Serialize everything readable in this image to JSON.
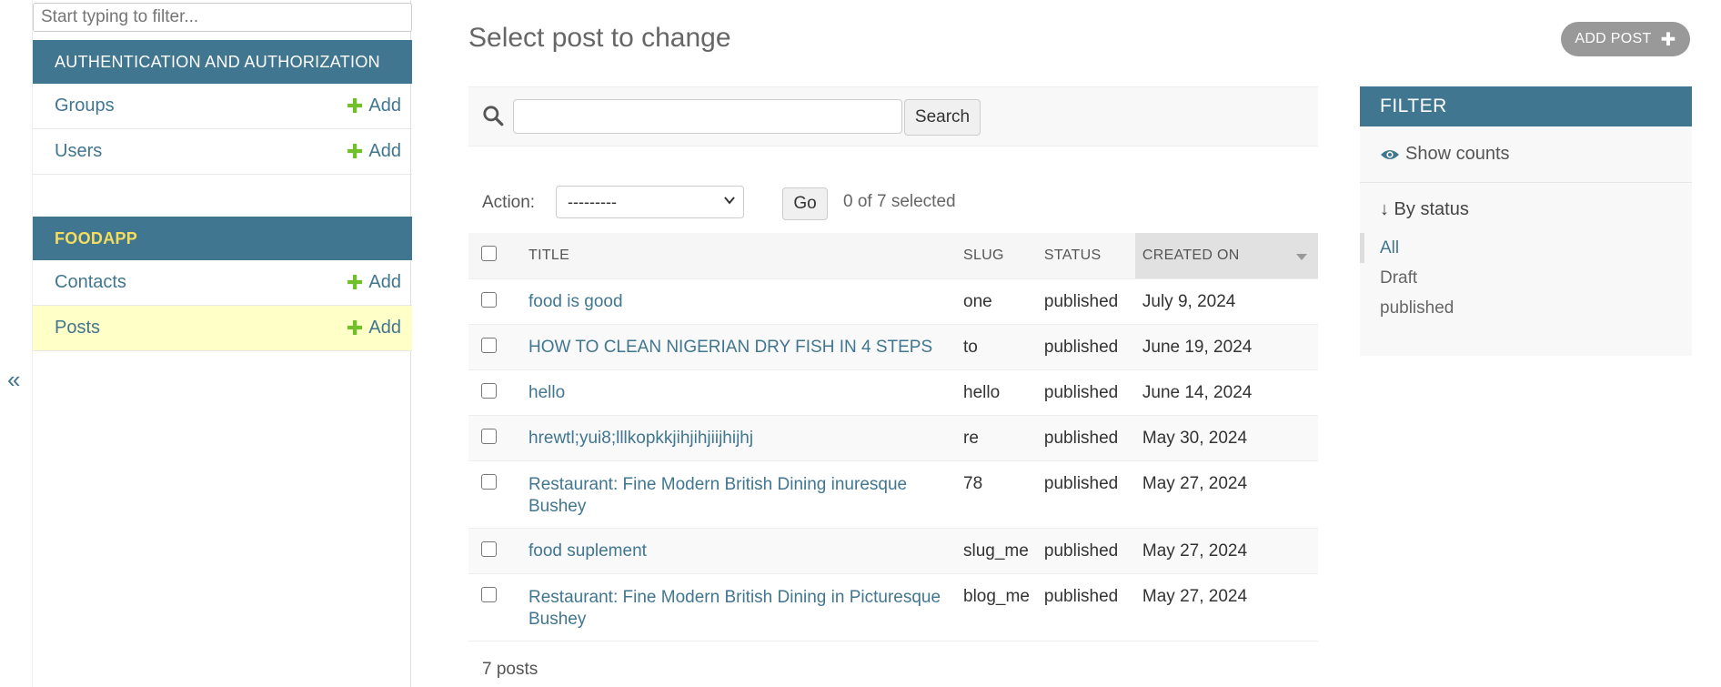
{
  "sidebar": {
    "filter_placeholder": "Start typing to filter...",
    "collapse_glyph": "«",
    "apps": [
      {
        "name": "AUTHENTICATION AND AUTHORIZATION",
        "models": [
          {
            "name": "Groups",
            "add_label": "Add"
          },
          {
            "name": "Users",
            "add_label": "Add"
          }
        ]
      },
      {
        "name": "FOODAPP",
        "models": [
          {
            "name": "Contacts",
            "add_label": "Add"
          },
          {
            "name": "Posts",
            "add_label": "Add",
            "current": true
          }
        ]
      }
    ]
  },
  "main": {
    "title": "Select post to change",
    "add_button": "ADD POST",
    "search_button": "Search",
    "action_label": "Action:",
    "action_value": "---------",
    "go_label": "Go",
    "selected_text": "0 of 7 selected",
    "columns": [
      "TITLE",
      "SLUG",
      "STATUS",
      "CREATED ON"
    ],
    "rows": [
      {
        "title": "food is good",
        "slug": "one",
        "status": "published",
        "created": "July 9, 2024"
      },
      {
        "title": "HOW TO CLEAN NIGERIAN DRY FISH IN 4 STEPS",
        "slug": "to",
        "status": "published",
        "created": "June 19, 2024"
      },
      {
        "title": "hello",
        "slug": "hello",
        "status": "published",
        "created": "June 14, 2024"
      },
      {
        "title": "hrewtl;yui8;lllkopkkjihjihjiijhijhj",
        "slug": "re",
        "status": "published",
        "created": "May 30, 2024"
      },
      {
        "title": "Restaurant: Fine Modern British Dining inuresque Bushey",
        "slug": "78",
        "status": "published",
        "created": "May 27, 2024"
      },
      {
        "title": "food suplement",
        "slug": "slug_me",
        "status": "published",
        "created": "May 27, 2024"
      },
      {
        "title": "Restaurant: Fine Modern British Dining in Picturesque Bushey",
        "slug": "blog_me",
        "status": "published",
        "created": "May 27, 2024"
      }
    ],
    "paginator": "7 posts"
  },
  "filter": {
    "title": "FILTER",
    "show_counts": "Show counts",
    "by_status": "↓ By status",
    "options": [
      "All",
      "Draft",
      "published"
    ]
  },
  "colors": {
    "header": "#417690",
    "current_row": "#ffffc8",
    "add_plus": "#70bf2b"
  }
}
